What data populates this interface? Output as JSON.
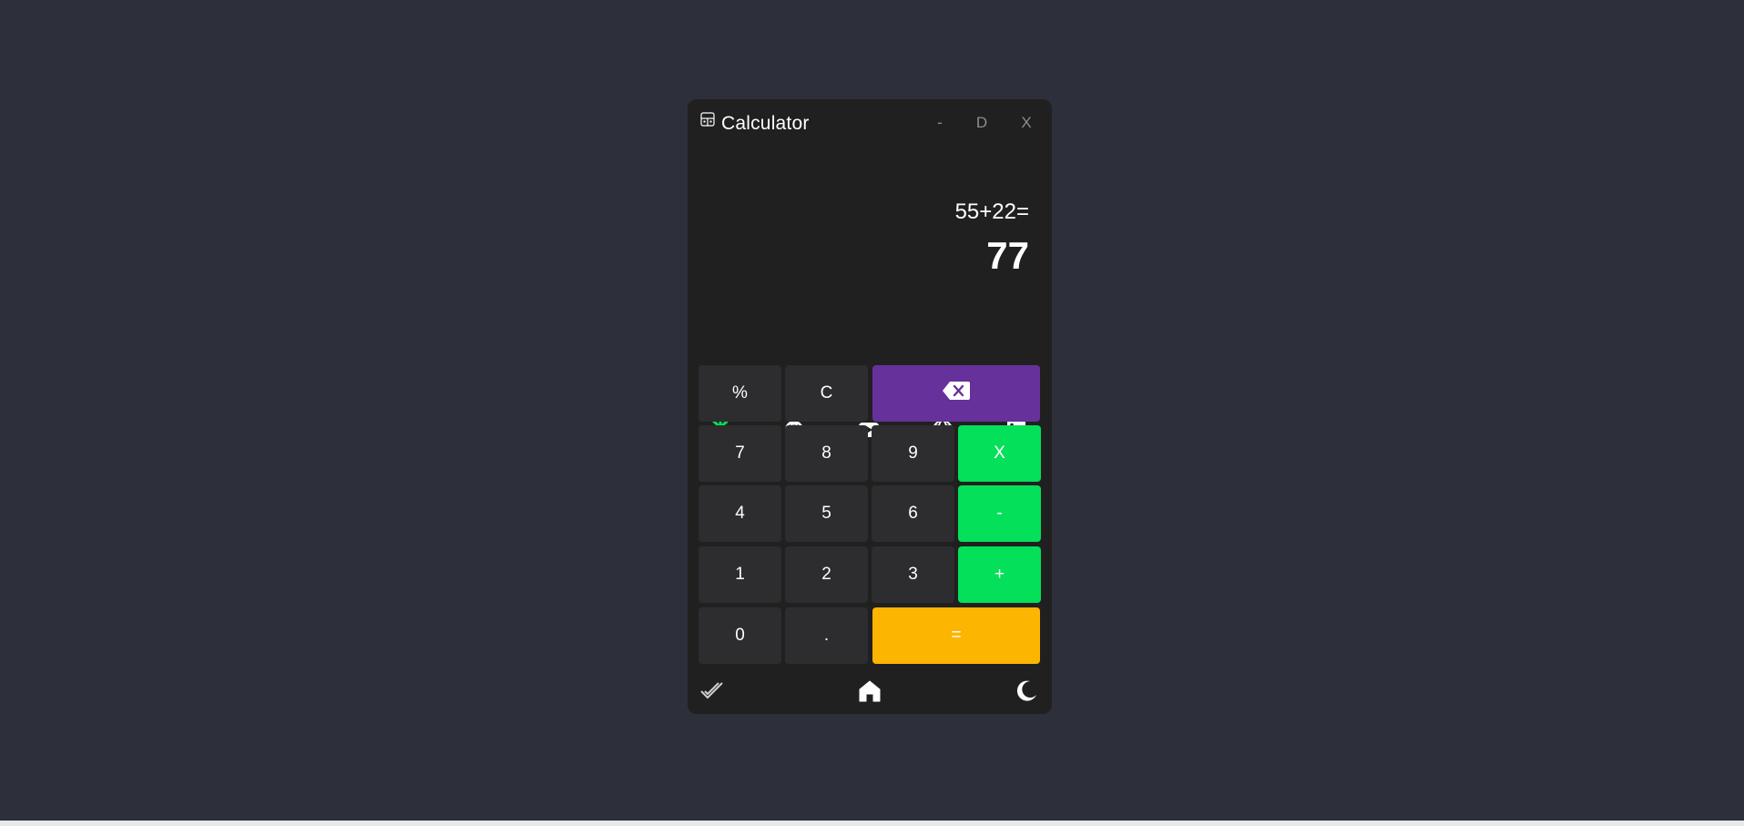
{
  "window": {
    "title": "Calculator",
    "minimize_label": "-",
    "maximize_label": "D",
    "close_label": "X"
  },
  "display": {
    "expression": "55+22=",
    "result": "77"
  },
  "social": [
    {
      "name": "linktree-icon",
      "color": "#04e05a"
    },
    {
      "name": "github-icon",
      "color": "#ffffff"
    },
    {
      "name": "youtube-icon",
      "color": "#ffffff"
    },
    {
      "name": "globe-icon",
      "color": "#ffffff"
    },
    {
      "name": "linkedin-icon",
      "color": "#ffffff"
    }
  ],
  "keys": {
    "percent": "%",
    "clear": "C",
    "backspace_icon": "backspace-icon",
    "seven": "7",
    "eight": "8",
    "nine": "9",
    "multiply": "X",
    "four": "4",
    "five": "5",
    "six": "6",
    "minus": "-",
    "one": "1",
    "two": "2",
    "three": "3",
    "plus": "+",
    "zero": "0",
    "dot": ".",
    "equals": "="
  },
  "footer": {
    "history_icon": "check-history-icon",
    "home_icon": "home-icon",
    "theme_icon": "moon-icon"
  },
  "colors": {
    "background": "#2d2f3a",
    "panel": "#202020",
    "key": "#2d2d2f",
    "operator": "#04e05a",
    "backspace": "#66319a",
    "equals": "#fcb500"
  }
}
